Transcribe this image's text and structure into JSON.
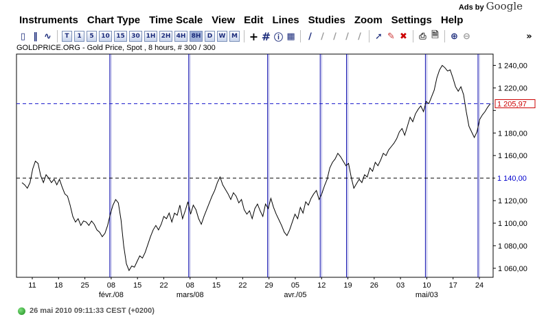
{
  "ads": {
    "prefix": "Ads by",
    "brand": "Google"
  },
  "menu": [
    "Instruments",
    "Chart Type",
    "Time Scale",
    "View",
    "Edit",
    "Lines",
    "Studies",
    "Zoom",
    "Settings",
    "Help"
  ],
  "toolbar": {
    "time_buttons": [
      "T",
      "1",
      "5",
      "10",
      "15",
      "30",
      "1H",
      "2H",
      "4H",
      "8H",
      "D",
      "W",
      "M"
    ]
  },
  "chart_title": "GOLDPRICE.ORG - Gold Price, Spot , 8 hours, # 300 / 300",
  "status": "26 mai 2010 09:11:33  CEST (+0200)",
  "colors": {
    "price_line": "#000000",
    "vline": "#0000aa",
    "dash_blue": "#1a1acc",
    "price_label": "#cc0000",
    "support_label": "#0000cc"
  },
  "chart_data": {
    "type": "line",
    "y_ticks": [
      "1 240,00",
      "1 220,00",
      "1 200,00",
      "1 180,00",
      "1 160,00",
      "1 140,00",
      "1 120,00",
      "1 100,00",
      "1 080,00",
      "1 060,00"
    ],
    "y_tick_values": [
      1240,
      1220,
      1200,
      1180,
      1160,
      1140,
      1120,
      1100,
      1080,
      1060
    ],
    "ylim": [
      1052,
      1250
    ],
    "x_ticks": [
      "11",
      "18",
      "25",
      "08",
      "15",
      "22",
      "08",
      "15",
      "22",
      "29",
      "05",
      "12",
      "19",
      "26",
      "03",
      "10",
      "17",
      "24"
    ],
    "month_labels": [
      "févr./08",
      "mars/08",
      "avr./05",
      "mai/03"
    ],
    "current_price": "1 205,97",
    "current_value": 1205.97,
    "support_label": "1 140,00",
    "support_value": 1140,
    "vertical_line_indices": [
      3,
      6,
      9,
      11,
      12,
      15,
      17
    ],
    "series": [
      {
        "values": [
          1136,
          1134,
          1131,
          1136,
          1148,
          1155,
          1153,
          1142,
          1136,
          1143,
          1140,
          1136,
          1139,
          1134,
          1139,
          1132,
          1126,
          1124,
          1116,
          1106,
          1101,
          1104,
          1098,
          1102,
          1101,
          1098,
          1102,
          1099,
          1094,
          1092,
          1088,
          1091,
          1098,
          1108,
          1116,
          1121,
          1118,
          1103,
          1080,
          1064,
          1058,
          1062,
          1061,
          1066,
          1071,
          1069,
          1074,
          1081,
          1088,
          1094,
          1098,
          1094,
          1099,
          1106,
          1104,
          1109,
          1101,
          1109,
          1107,
          1116,
          1104,
          1111,
          1119,
          1108,
          1116,
          1112,
          1104,
          1099,
          1106,
          1112,
          1118,
          1124,
          1129,
          1136,
          1141,
          1134,
          1130,
          1126,
          1121,
          1127,
          1124,
          1118,
          1121,
          1112,
          1108,
          1111,
          1104,
          1113,
          1117,
          1111,
          1106,
          1117,
          1113,
          1122,
          1114,
          1108,
          1103,
          1098,
          1092,
          1089,
          1094,
          1101,
          1108,
          1104,
          1114,
          1109,
          1119,
          1116,
          1122,
          1126,
          1129,
          1121,
          1126,
          1133,
          1139,
          1149,
          1154,
          1157,
          1162,
          1159,
          1155,
          1151,
          1153,
          1141,
          1131,
          1135,
          1139,
          1136,
          1143,
          1141,
          1149,
          1146,
          1154,
          1151,
          1156,
          1162,
          1160,
          1165,
          1168,
          1171,
          1175,
          1181,
          1184,
          1178,
          1186,
          1194,
          1190,
          1197,
          1201,
          1204,
          1199,
          1208,
          1206,
          1212,
          1218,
          1229,
          1236,
          1240,
          1238,
          1235,
          1236,
          1229,
          1221,
          1217,
          1221,
          1214,
          1199,
          1186,
          1181,
          1176,
          1181,
          1192,
          1196,
          1199,
          1203,
          1206
        ]
      }
    ]
  }
}
